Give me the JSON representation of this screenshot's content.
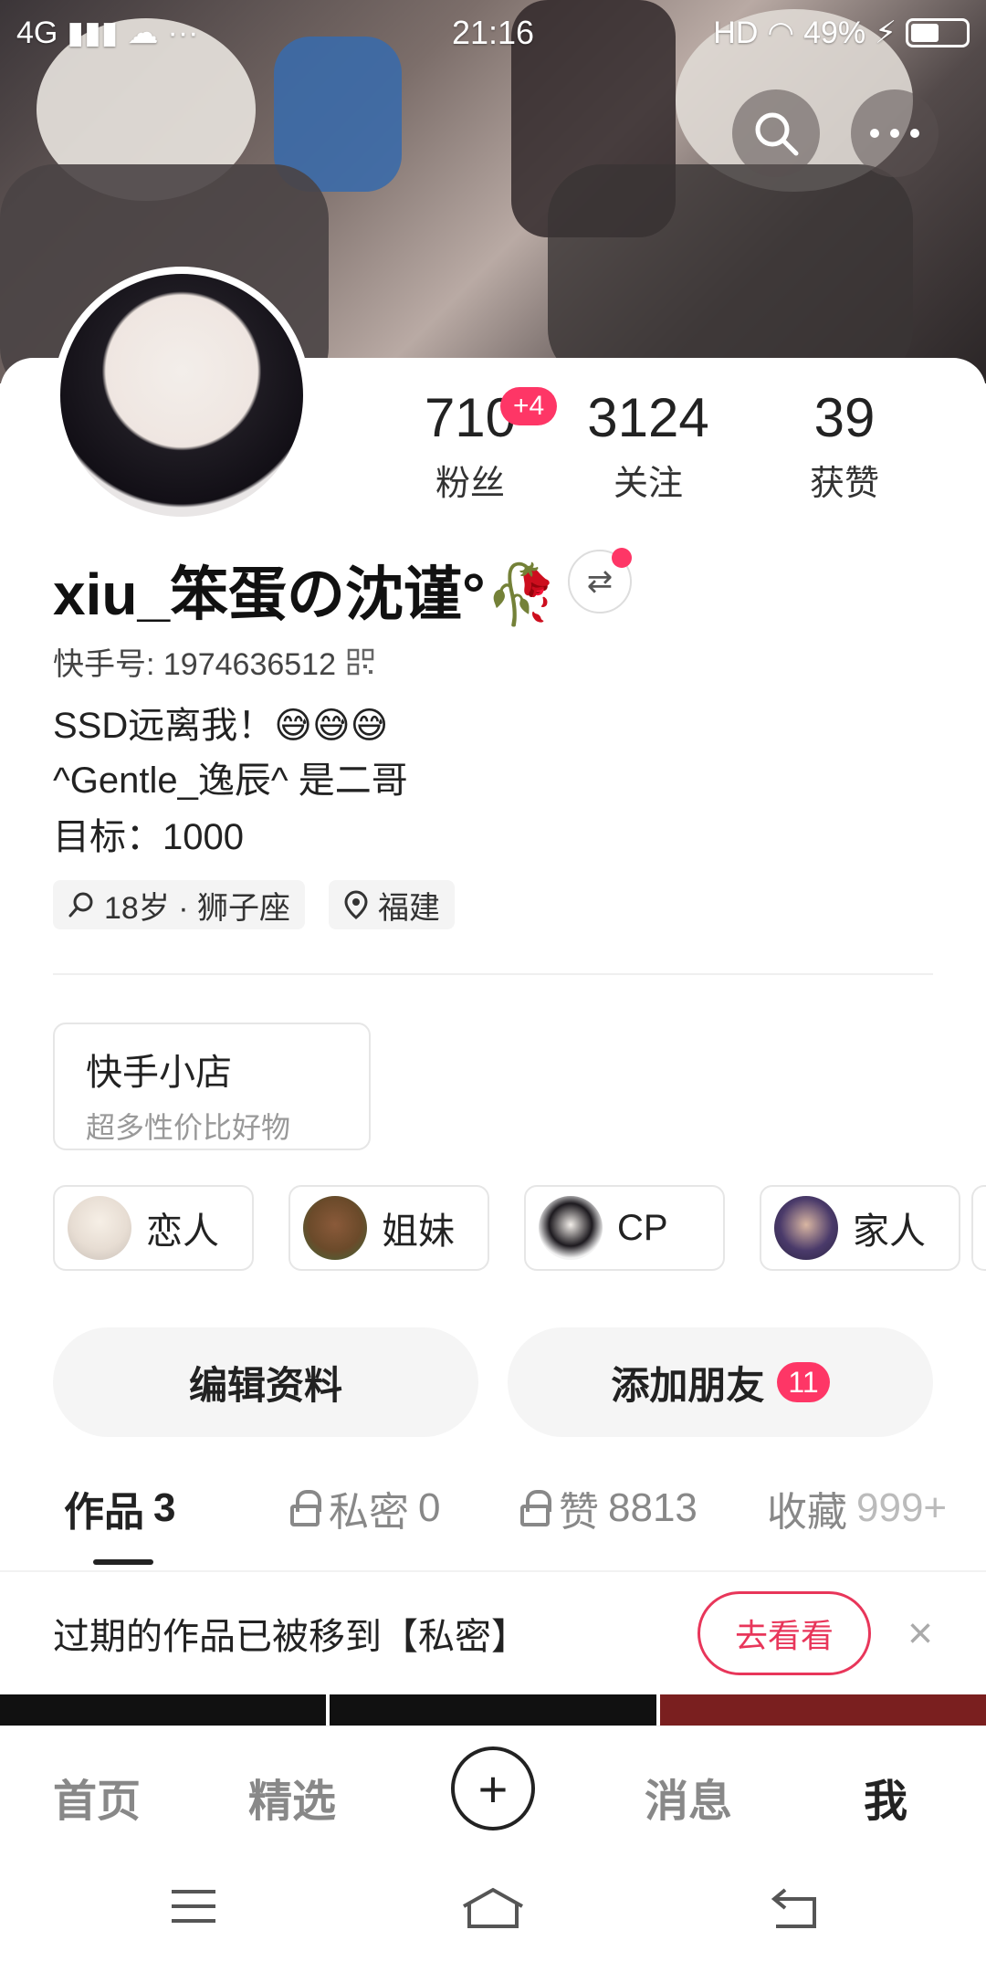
{
  "status_bar": {
    "network": "4G",
    "time": "21:16",
    "hd": "HD",
    "battery": "49%"
  },
  "profile": {
    "name": "xiu_笨蛋の沈谨°🥀",
    "kuaishou_id": "快手号: 1974636512",
    "bio_lines": [
      "SSD远离我！😅😅😅",
      "^Gentle_逸辰^   是二哥",
      "目标：1000"
    ],
    "tags": [
      "18岁 · 狮子座",
      "福建"
    ]
  },
  "stats": [
    {
      "num": "710",
      "label": "粉丝",
      "badge": "+4"
    },
    {
      "num": "3124",
      "label": "关注"
    },
    {
      "num": "39",
      "label": "获赞"
    }
  ],
  "shop": {
    "title": "快手小店",
    "subtitle": "超多性价比好物"
  },
  "relations": [
    "恋人",
    "姐妹",
    "CP",
    "家人"
  ],
  "buttons": {
    "edit": "编辑资料",
    "add_friend": "添加朋友",
    "add_friend_count": "11"
  },
  "tabs": [
    {
      "label": "作品",
      "count": "3"
    },
    {
      "label": "私密",
      "count": "0"
    },
    {
      "label": "赞",
      "count": "8813"
    },
    {
      "label": "收藏",
      "count": "999+"
    }
  ],
  "notice": {
    "text": "过期的作品已被移到【私密】",
    "action": "去看看",
    "close": "×"
  },
  "bottom_nav": [
    "首页",
    "精选",
    "+",
    "消息",
    "我"
  ],
  "icons": [
    "search-icon",
    "more-icon",
    "qrcode-icon",
    "switch-icon",
    "location-icon",
    "lock-icon",
    "close-icon"
  ],
  "colors": {
    "accent": "#fe3666",
    "notice_button": "#e8365a"
  }
}
